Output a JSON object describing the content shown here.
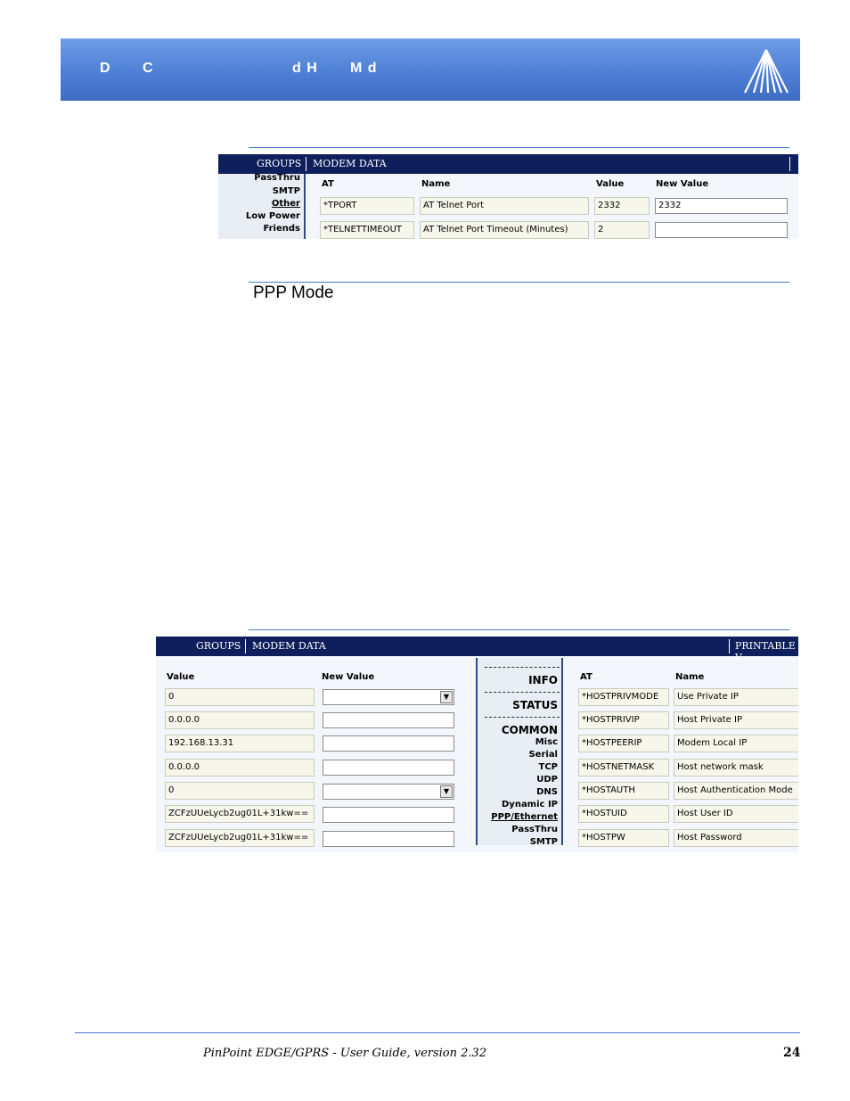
{
  "header": {
    "left_chars": [
      "D",
      "C"
    ],
    "mid_text": "d H",
    "mid_text2": "M d"
  },
  "screenshot1": {
    "nav": {
      "groups": "GROUPS",
      "modem_data": "MODEM DATA"
    },
    "left_menu": [
      "PassThru",
      "SMTP",
      "Other",
      "Low Power",
      "Friends"
    ],
    "columns": {
      "at": "AT",
      "name": "Name",
      "value": "Value",
      "new_value": "New Value"
    },
    "rows": [
      {
        "at": "*TPORT",
        "name": "AT Telnet Port",
        "value": "2332",
        "new_value": "2332"
      },
      {
        "at": "*TELNETTIMEOUT",
        "name": "AT Telnet Port Timeout (Minutes)",
        "value": "2",
        "new_value": ""
      }
    ]
  },
  "section_title": "PPP Mode",
  "screenshot2": {
    "nav": {
      "groups": "GROUPS",
      "modem_data": "MODEM DATA",
      "printable": "PRINTABLE V"
    },
    "left_columns": {
      "value": "Value",
      "new_value": "New Value"
    },
    "left_rows": [
      {
        "value": "0",
        "kind": "select"
      },
      {
        "value": "0.0.0.0",
        "kind": "input"
      },
      {
        "value": "192.168.13.31",
        "kind": "input"
      },
      {
        "value": "0.0.0.0",
        "kind": "input"
      },
      {
        "value": "0",
        "kind": "select"
      },
      {
        "value": "ZCFzUUeLycb2ug01L+31kw==",
        "kind": "input"
      },
      {
        "value": "ZCFzUUeLycb2ug01L+31kw==",
        "kind": "input"
      }
    ],
    "group_menu": {
      "info": "INFO",
      "status": "STATUS",
      "common": "COMMON",
      "items": [
        "Misc",
        "Serial",
        "TCP",
        "UDP",
        "DNS",
        "Dynamic IP",
        "PPP/Ethernet",
        "PassThru",
        "SMTP"
      ]
    },
    "right_columns": {
      "at": "AT",
      "name": "Name"
    },
    "right_rows": [
      {
        "at": "*HOSTPRIVMODE",
        "name": "Use Private IP"
      },
      {
        "at": "*HOSTPRIVIP",
        "name": "Host Private IP"
      },
      {
        "at": "*HOSTPEERIP",
        "name": "Modem Local IP"
      },
      {
        "at": "*HOSTNETMASK",
        "name": "Host network mask"
      },
      {
        "at": "*HOSTAUTH",
        "name": "Host Authentication Mode"
      },
      {
        "at": "*HOSTUID",
        "name": "Host User ID"
      },
      {
        "at": "*HOSTPW",
        "name": "Host Password"
      }
    ]
  },
  "footer": {
    "text": "PinPoint EDGE/GPRS - User Guide, version 2.32",
    "page": "24"
  },
  "colors": {
    "banner": "#4f7fd6",
    "nav": "#0f1f5c",
    "rule": "#4a78c9"
  }
}
